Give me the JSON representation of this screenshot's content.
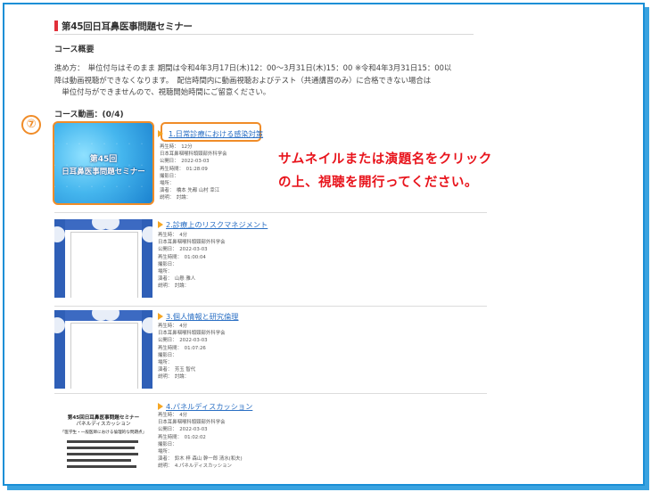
{
  "page": {
    "title": "第45回日耳鼻医事問題セミナー",
    "overview_heading": "コース概要",
    "description_lines": [
      "進め方：　単位付与はそのまま 期間は令和4年3月17日(木)12：00～3月31日(木)15：00 ※令和4年3月31日15：00以",
      "降は動画視聴ができなくなります。　配信時間内に動画視聴およびテスト（共通講習のみ）に合格できない場合は",
      "　単位付与ができませんので、視聴開始時間にご留意ください。"
    ],
    "course_videos_heading": "コース動画：(0/4)"
  },
  "annotation": {
    "step_number": "⑦",
    "note_lines": [
      "サムネイルまたは演題名をクリック",
      "の上、視聴を開行ってください。"
    ],
    "highlight_color": "#f08c28",
    "note_color": "#e8141c"
  },
  "courses": [
    {
      "title": "1.日常診療における感染対策",
      "thumb_lines": [
        "第45回",
        "日耳鼻医事問題セミナー"
      ],
      "meta": [
        "再生時：　12分",
        "日本耳鼻咽喉科頭頸部外科学会",
        "公開日：　2022-03-03",
        "再生時間：　01:28:09",
        "撮影日：",
        "場所：",
        "演者：　橋本 先都 山村 幸江",
        "説明：　討論："
      ]
    },
    {
      "title": "2.診療上のリスクマネジメント",
      "meta": [
        "再生時：　4分",
        "日本耳鼻咽喉科頭頸部外科学会",
        "公開日：　2022-03-03",
        "再生時間：　01:00:04",
        "撮影日：",
        "場所：",
        "演者：　山懸 雅人",
        "説明：　討論："
      ]
    },
    {
      "title": "3.個人情報と研究倫理",
      "meta": [
        "再生時：　4分",
        "日本耳鼻咽喉科頭頸部外科学会",
        "公開日：　2022-03-03",
        "再生時間：　01:07:26",
        "撮影日：",
        "場所：",
        "演者：　芳玉 智代",
        "説明：　討論："
      ]
    },
    {
      "title": "4.パネルディスカッション",
      "thumb_lines": [
        "第45回日耳鼻医事問題セミナー",
        "パネルディスカッション",
        "「医学生・一般医師における倫理的な問題点」"
      ],
      "meta": [
        "再生時：　4分",
        "日本耳鼻咽喉科頭頸部外科学会",
        "公開日：　2022-03-03",
        "再生時間：　01:02:02",
        "撮影日：",
        "場所：",
        "演者：　鈴木 梓 森山 幹一郎 清水(和夫)",
        "説明：　4.パネルディスカッション"
      ]
    }
  ]
}
